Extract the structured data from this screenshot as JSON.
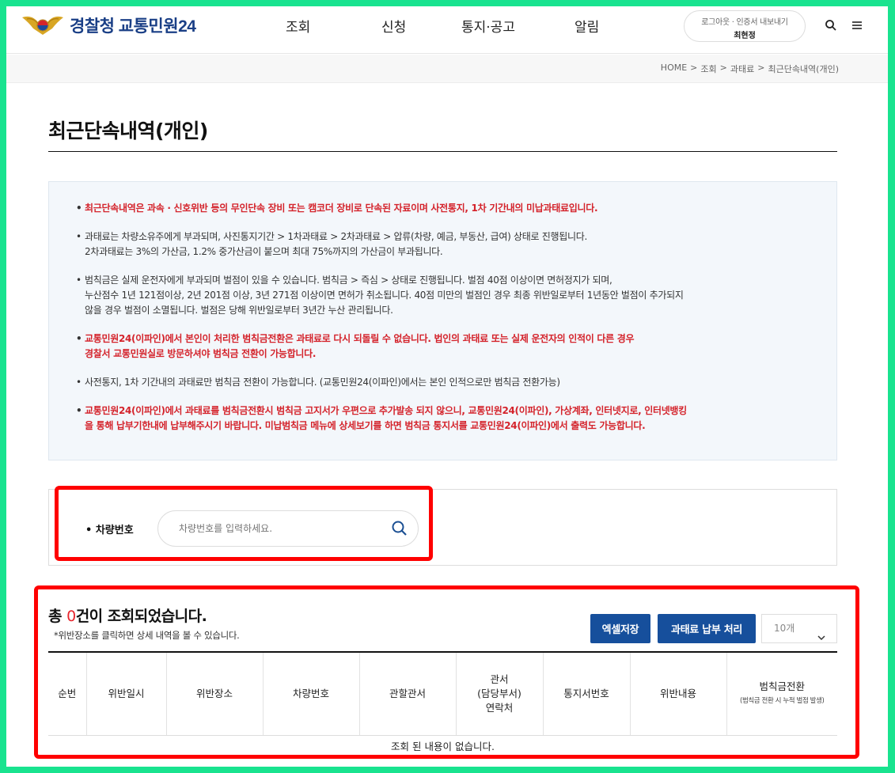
{
  "header": {
    "logo_text": "경찰청 교통민원24",
    "nav": [
      "조회",
      "신청",
      "통지·공고",
      "알림"
    ],
    "auth_links": "로그아웃 · 인증서 내보내기",
    "user_name": "최현정"
  },
  "breadcrumb": [
    "HOME",
    ">",
    "조회",
    ">",
    "과태료",
    ">",
    "최근단속내역(개인)"
  ],
  "page_title": "최근단속내역(개인)",
  "notice": [
    {
      "red": true,
      "text": "최근단속내역은 과속 · 신호위반 등의 무인단속 장비 또는 캠코더 장비로 단속된 자료이며 사전통지, 1차 기간내의 미납과태료입니다."
    },
    {
      "red": false,
      "text": "과태료는 차량소유주에게 부과되며, 사진통지기간 > 1차과태료 > 2차과태료 > 압류(차량, 예금, 부동산, 급여) 상태로 진행됩니다.\n2차과태료는 3%의 가산금, 1.2% 중가산금이 붙으며 최대 75%까지의 가산금이 부과됩니다."
    },
    {
      "red": false,
      "text": "범칙금은 실제 운전자에게 부과되며 벌점이 있을 수 있습니다. 범칙금 > 즉심 > 상태로 진행됩니다. 벌점 40점 이상이면 면허정지가 되며,\n누산점수 1년 121점이상, 2년 201점 이상, 3년 271점 이상이면 면허가 취소됩니다. 40점 미만의 벌점인 경우 최종 위반일로부터 1년동안 벌점이 추가되지\n않을 경우 벌점이 소멸됩니다. 벌점은 당해 위반일로부터 3년간 누산 관리됩니다."
    },
    {
      "red": true,
      "text": "교통민원24(이파인)에서 본인이 처리한 범칙금전환은 과태료로 다시 되돌릴 수 없습니다. 법인의 과태료 또는 실제 운전자의 인적이 다른 경우\n경찰서 교통민원실로 방문하셔야 범칙금 전환이 가능합니다."
    },
    {
      "red": false,
      "text": "사전통지, 1차 기간내의 과태료만 범칙금 전환이 가능합니다. (교통민원24(이파인)에서는 본인 인적으로만 범칙금 전환가능)"
    },
    {
      "red": true,
      "text": "교통민원24(이파인)에서 과태료를 범칙금전환시 범칙금 고지서가 우편으로 추가발송 되지 않으니, 교통민원24(이파인), 가상계좌, 인터넷지로, 인터넷뱅킹\n을 통해 납부기한내에 납부해주시기 바랍니다. 미납범칙금 메뉴에 상세보기를 하면 범칙금 통지서를 교통민원24(이파인)에서 출력도 가능합니다."
    }
  ],
  "search": {
    "label": "• 차량번호",
    "placeholder": "차량번호를 입력하세요."
  },
  "results": {
    "total_prefix": "총 ",
    "count": "0",
    "total_suffix": "건이 조회되었습니다.",
    "subnote": "*위반장소를 클릭하면 상세 내역을 볼 수 있습니다.",
    "excel_button": "엑셀저장",
    "pay_button": "과태료 납부 처리",
    "page_size": "10개"
  },
  "table": {
    "columns": [
      {
        "label": "순번"
      },
      {
        "label": "위반일시"
      },
      {
        "label": "위반장소"
      },
      {
        "label": "차량번호"
      },
      {
        "label": "관할관서"
      },
      {
        "label": "관서\n(담당부서)\n연락처"
      },
      {
        "label": "통지서번호"
      },
      {
        "label": "위반내용"
      },
      {
        "label": "범칙금전환",
        "sub": "(범칙금 전환 시 누적 벌점 발생)"
      }
    ],
    "empty_text": "조회 된 내용이 없습니다."
  },
  "colors": {
    "brand_blue": "#164f9c",
    "alert_red": "#d4232b",
    "highlight_red": "#ff0000",
    "outer_green": "#19e38f"
  }
}
